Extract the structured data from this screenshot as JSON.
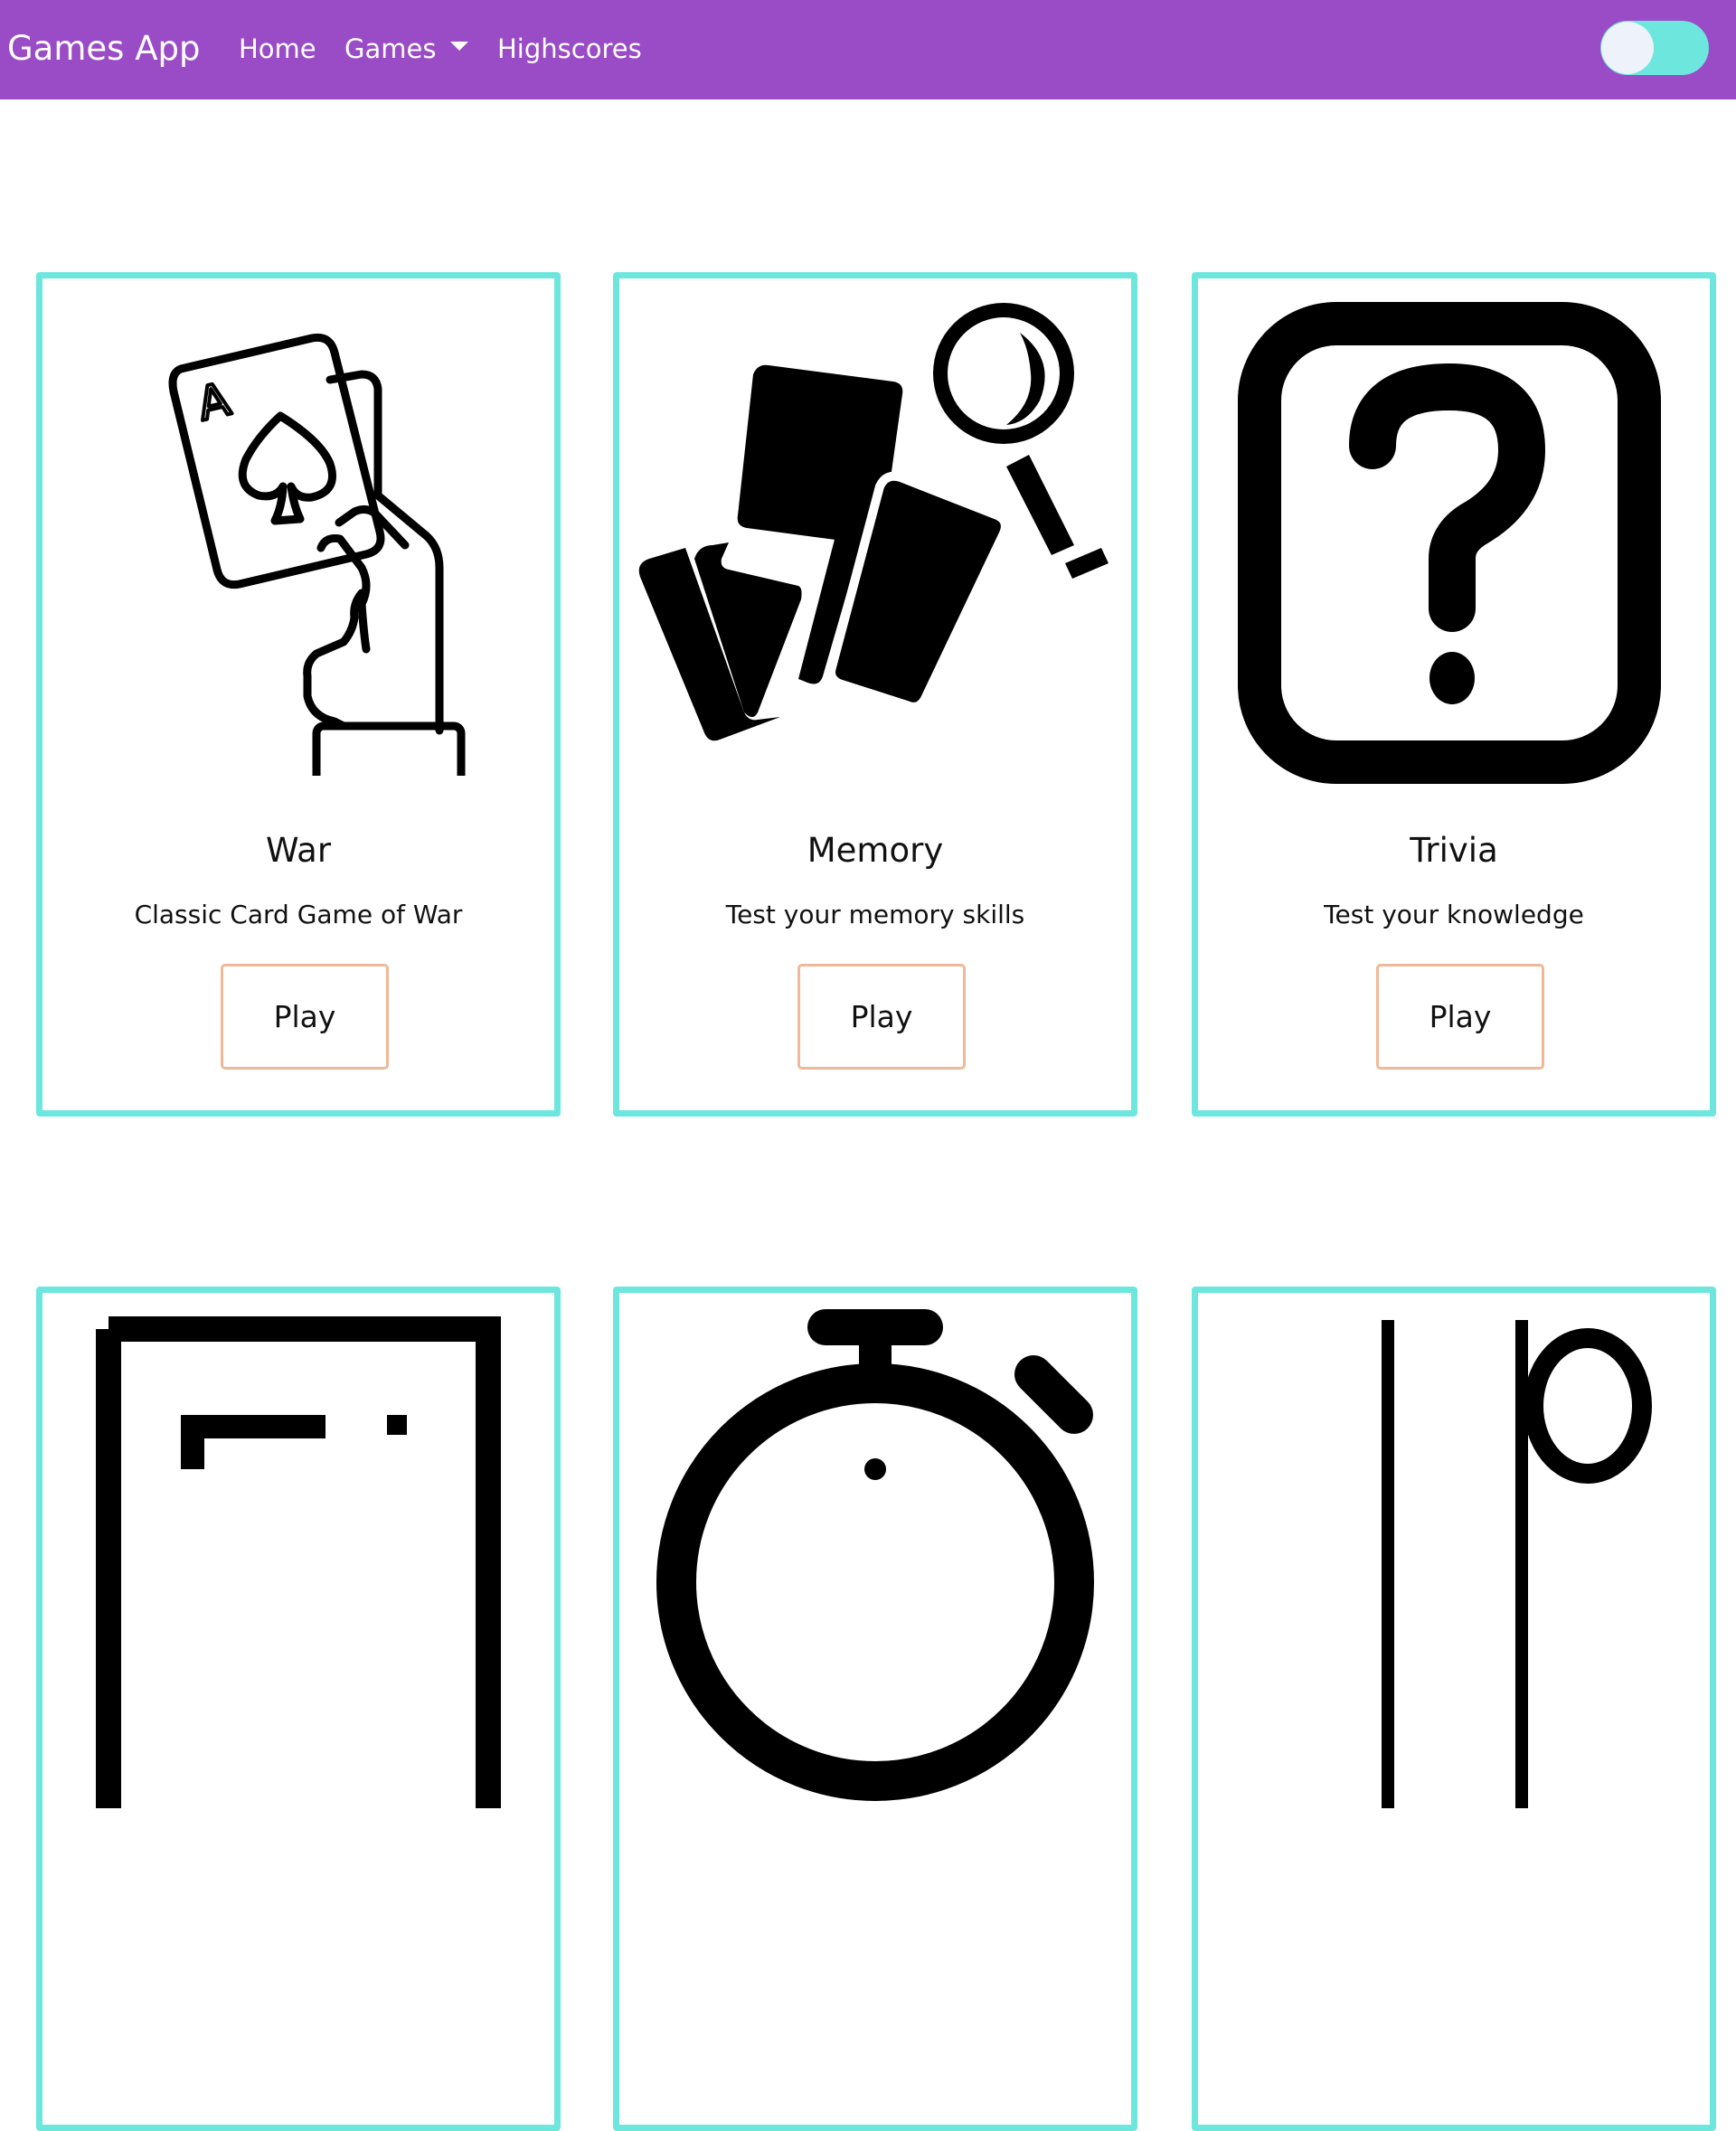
{
  "navbar": {
    "brand": "Games App",
    "links": {
      "home": "Home",
      "games": "Games",
      "highscores": "Highscores"
    },
    "colors": {
      "background": "#9a4bc6",
      "toggle": "#6de6de"
    }
  },
  "cards": [
    {
      "title": "War",
      "description": "Classic Card Game of War",
      "button": "Play",
      "icon": "hand-holding-cards-icon"
    },
    {
      "title": "Memory",
      "description": "Test your memory skills",
      "button": "Play",
      "icon": "cards-magnifier-icon"
    },
    {
      "title": "Trivia",
      "description": "Test your knowledge",
      "button": "Play",
      "icon": "question-mark-box-icon"
    },
    {
      "title": "",
      "description": "",
      "button": "",
      "icon": "window-frame-icon"
    },
    {
      "title": "",
      "description": "",
      "button": "",
      "icon": "stopwatch-icon"
    },
    {
      "title": "",
      "description": "",
      "button": "",
      "icon": "number-ten-icon"
    }
  ],
  "colors": {
    "card_border": "#6de6de",
    "button_border": "#f0b896"
  }
}
